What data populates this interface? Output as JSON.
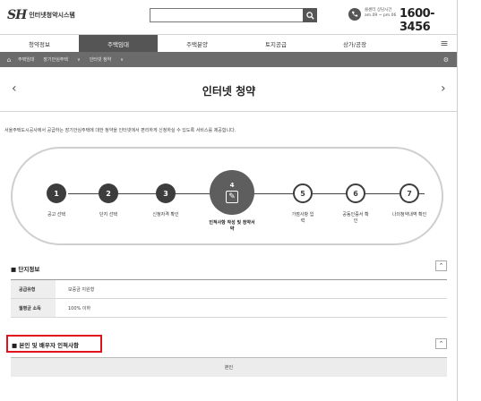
{
  "header": {
    "logo_mark": "SH",
    "logo_name": "인터넷청약시스템",
    "hours_line1": "콜센터 상담시간",
    "hours_line2": "am.09 ~ pm.06",
    "phone": "1600-3456"
  },
  "nav": {
    "items": [
      {
        "label": "청약정보",
        "active": false
      },
      {
        "label": "주택임대",
        "active": true
      },
      {
        "label": "주택분양",
        "active": false
      },
      {
        "label": "토지공급",
        "active": false
      },
      {
        "label": "상가/공장",
        "active": false
      }
    ]
  },
  "breadcrumb": {
    "items": [
      "주택임대",
      "장기안심주택",
      "인터넷 청약"
    ]
  },
  "page": {
    "title": "인터넷 청약",
    "description": "서울주택도시공사에서 공급하는 장기안심주택에 대한 청약을 인터넷에서 편리하게 신청하실 수 있도록 서비스를 제공합니다."
  },
  "steps": [
    {
      "num": "1",
      "label": "공고 선택",
      "state": "done"
    },
    {
      "num": "2",
      "label": "단지 선택",
      "state": "done"
    },
    {
      "num": "3",
      "label": "신청자격 확인",
      "state": "done"
    },
    {
      "num": "4",
      "label": "인적사항 작성 및 청약서약",
      "state": "current"
    },
    {
      "num": "5",
      "label": "가점사항 입력",
      "state": "todo"
    },
    {
      "num": "6",
      "label": "공동인증서 확인",
      "state": "todo"
    },
    {
      "num": "7",
      "label": "나의청약내역 확인",
      "state": "todo"
    }
  ],
  "complex_info": {
    "title": "■ 단지정보",
    "rows": [
      {
        "label": "공급유형",
        "value": "보증금 지원형"
      },
      {
        "label": "월평균 소득",
        "value": "100% 이하"
      }
    ]
  },
  "personal_info": {
    "title": "■ 본인 및 배우자 인적사항",
    "self_label": "본인"
  },
  "colors": {
    "highlight": "#e0121a",
    "step_dark": "#3d3d3d",
    "breadcrumb_bg": "#6b6b6b"
  }
}
